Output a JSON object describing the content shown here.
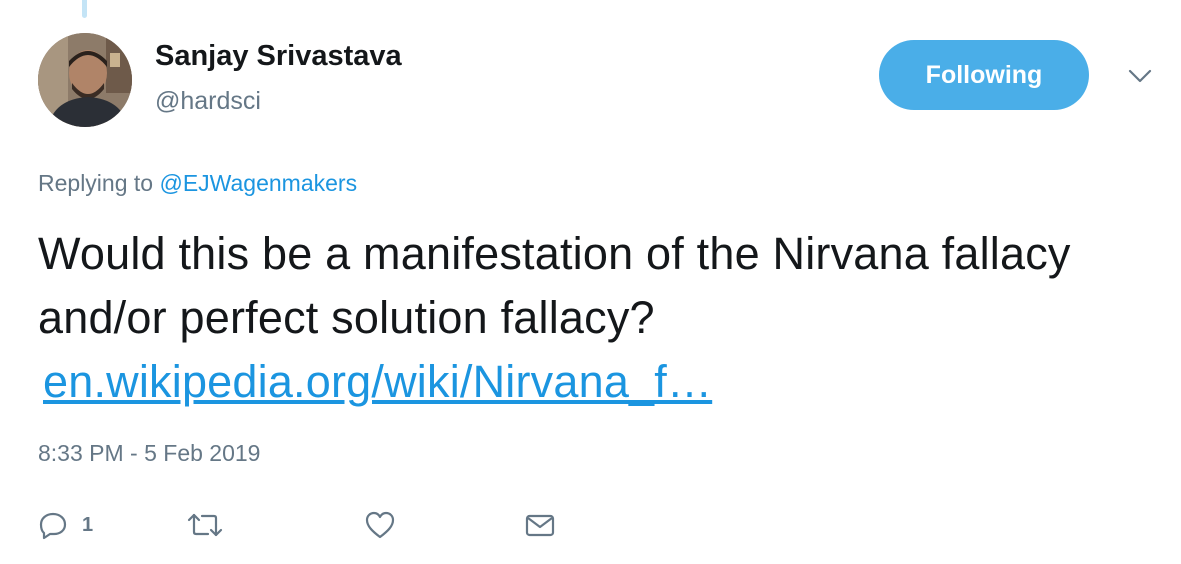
{
  "author": {
    "name": "Sanjay Srivastava",
    "handle": "@hardsci"
  },
  "follow_button": {
    "label": "Following",
    "color": "#4aaee8"
  },
  "reply_context": {
    "prefix": "Replying to",
    "mention": "@EJWagenmakers"
  },
  "tweet": {
    "text": "Would this be a manifestation of the Nirvana fallacy and/or perfect solution fallacy?",
    "link_text": "en.wikipedia.org/wiki/Nirvana_f…",
    "timestamp": "8:33 PM - 5 Feb 2019"
  },
  "actions": {
    "reply_count": "1",
    "icons": [
      "reply-icon",
      "retweet-icon",
      "like-icon",
      "direct-message-icon"
    ]
  },
  "colors": {
    "link": "#1b95e0",
    "secondary_text": "#657786",
    "primary_text": "#14171a"
  }
}
